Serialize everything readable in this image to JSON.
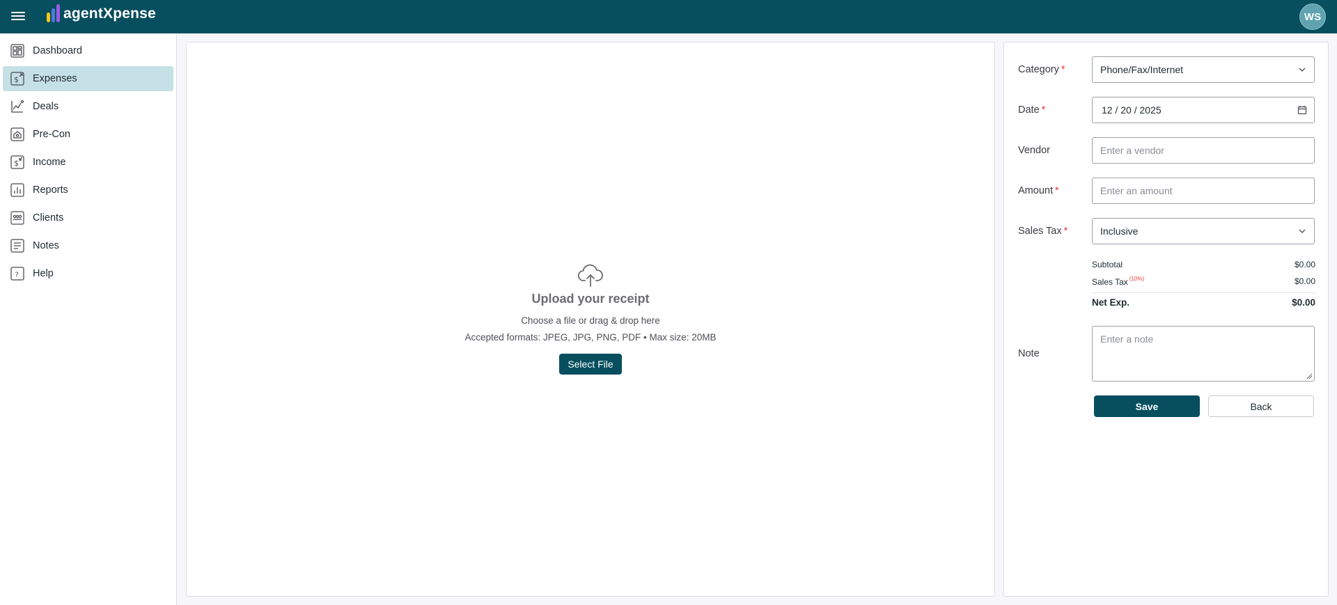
{
  "app": {
    "name": "agentXpense",
    "user_initials": "WS"
  },
  "logo_colors": [
    "#f5c518",
    "#4a7bd8",
    "#9b5de5"
  ],
  "sidebar": {
    "items": [
      {
        "label": "Dashboard",
        "icon": "dashboard-icon",
        "active": false
      },
      {
        "label": "Expenses",
        "icon": "dollar-receipt-icon",
        "active": true
      },
      {
        "label": "Deals",
        "icon": "chart-line-icon",
        "active": false
      },
      {
        "label": "Pre-Con",
        "icon": "house-icon",
        "active": false
      },
      {
        "label": "Income",
        "icon": "income-icon",
        "active": false
      },
      {
        "label": "Reports",
        "icon": "bar-chart-icon",
        "active": false
      },
      {
        "label": "Clients",
        "icon": "clients-icon",
        "active": false
      },
      {
        "label": "Notes",
        "icon": "notes-icon",
        "active": false
      },
      {
        "label": "Help",
        "icon": "help-icon",
        "active": false
      }
    ]
  },
  "upload": {
    "title": "Upload your receipt",
    "subtitle": "Choose a file or drag & drop here",
    "formats": "Accepted formats: JPEG, JPG, PNG, PDF • Max size: 20MB",
    "button": "Select File"
  },
  "form": {
    "category": {
      "label": "Category",
      "value": "Phone/Fax/Internet"
    },
    "date": {
      "label": "Date",
      "value": "12 / 20 / 2025"
    },
    "vendor": {
      "label": "Vendor",
      "placeholder": "Enter a vendor"
    },
    "amount": {
      "label": "Amount",
      "placeholder": "Enter an amount"
    },
    "sales_tax": {
      "label": "Sales Tax",
      "value": "Inclusive"
    },
    "summary": {
      "subtotal_label": "Subtotal",
      "subtotal": "$0.00",
      "tax_label": "Sales Tax",
      "tax_rate": "(10%)",
      "tax": "$0.00",
      "net_label": "Net Exp.",
      "net": "$0.00"
    },
    "note": {
      "label": "Note",
      "placeholder": "Enter a note"
    },
    "save": "Save",
    "back": "Back"
  }
}
